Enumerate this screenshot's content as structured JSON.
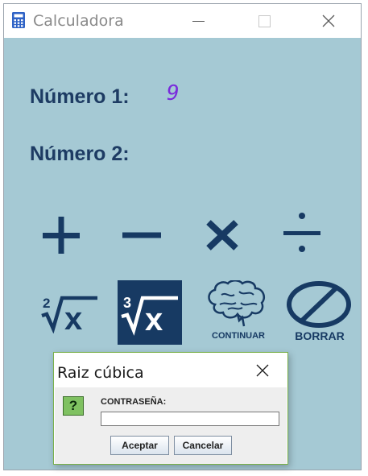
{
  "window": {
    "title": "Calculadora"
  },
  "labels": {
    "numero1": "Número 1:",
    "numero2": "Número 2:"
  },
  "values": {
    "numero1": "9",
    "numero2": ""
  },
  "operations": {
    "sqrt2_index": "2",
    "sqrt3_index": "3",
    "radicand": "x",
    "continue_label": "CONTINUAR",
    "clear_label": "BORRAR"
  },
  "dialog": {
    "title": "Raiz cúbica",
    "field_label": "CONTRASEÑA:",
    "input_value": "",
    "accept_label": "Aceptar",
    "cancel_label": "Cancelar"
  },
  "colors": {
    "background": "#a5c9d4",
    "icon_blue": "#173a63",
    "number_color": "#7a2bdc",
    "dialog_border": "#79b04a"
  },
  "icons": {
    "app": "calculator-icon",
    "add": "plus-icon",
    "subtract": "minus-icon",
    "multiply": "times-icon",
    "divide": "divide-icon",
    "continue": "brain-icon",
    "clear": "no-symbol-icon",
    "dialog": "question-icon"
  }
}
